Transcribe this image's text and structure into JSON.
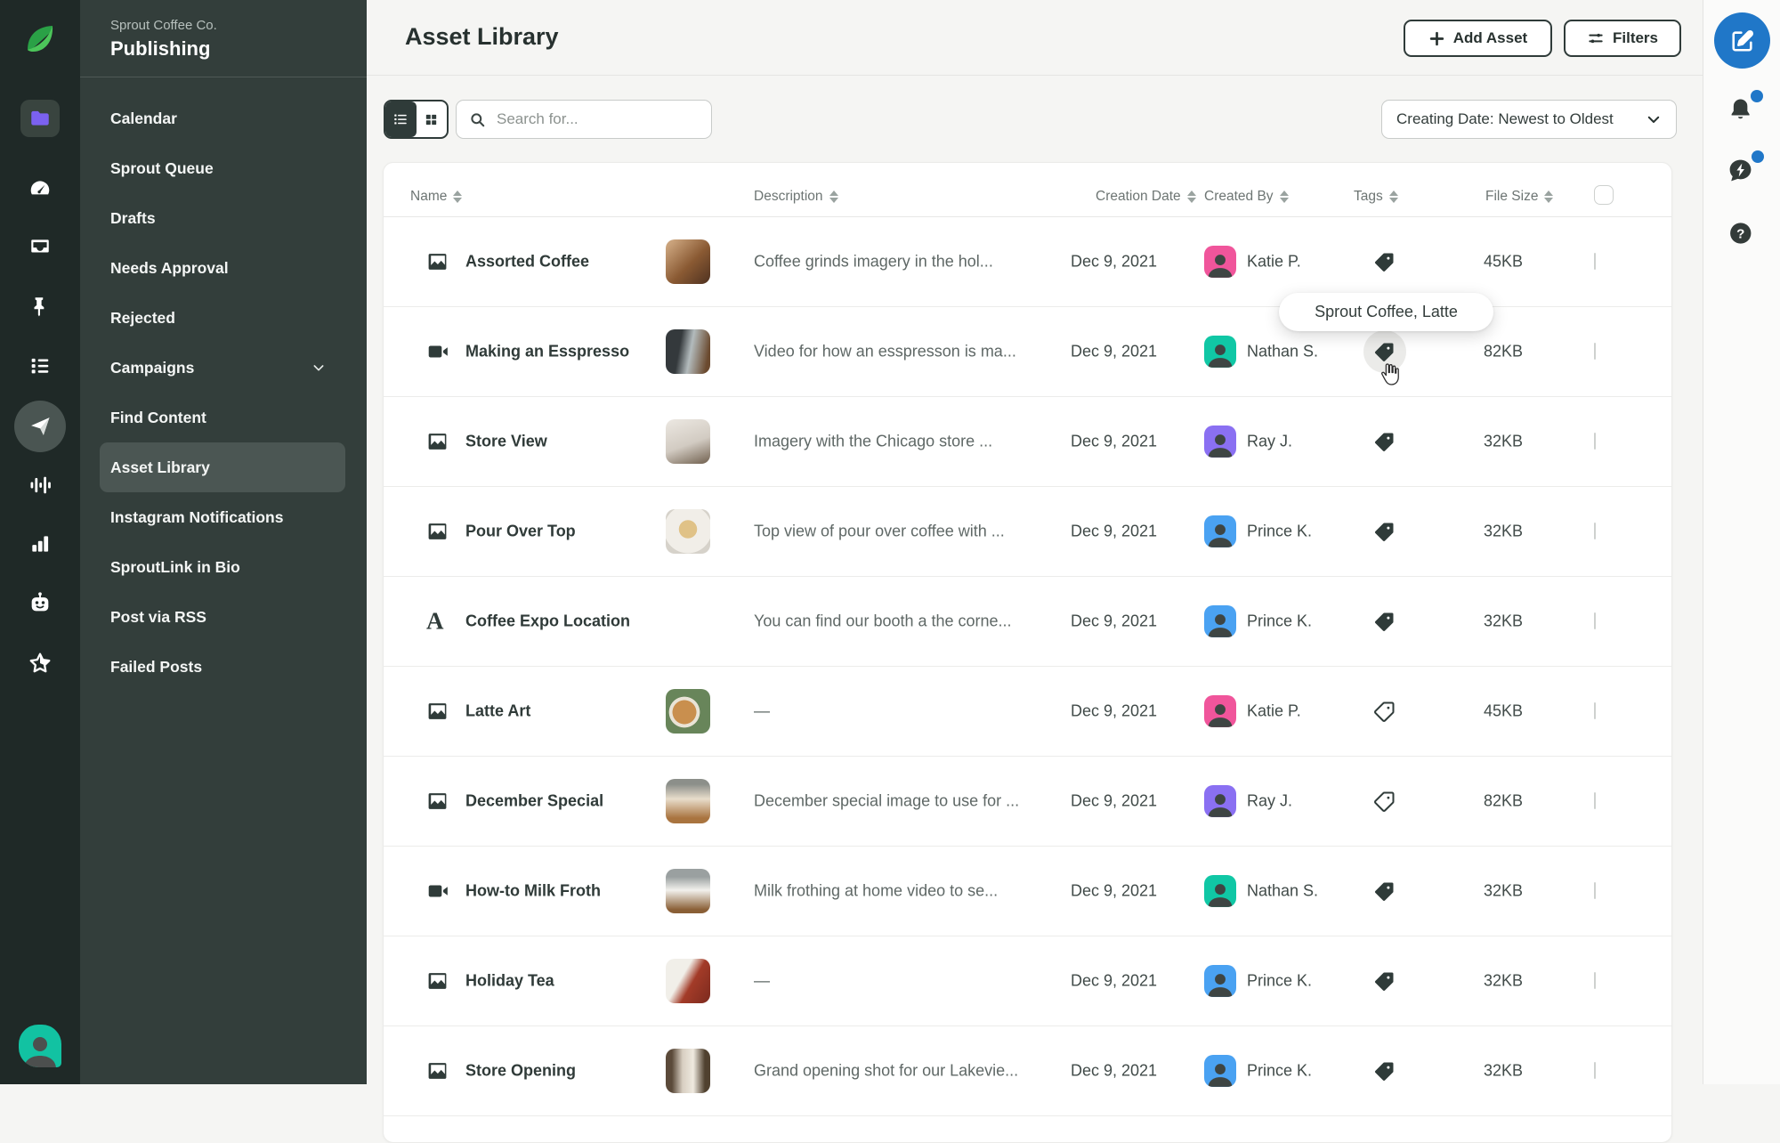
{
  "app": {
    "account": "Sprout Coffee Co.",
    "section": "Publishing"
  },
  "sidebar": {
    "items": [
      {
        "label": "Calendar"
      },
      {
        "label": "Sprout Queue"
      },
      {
        "label": "Drafts"
      },
      {
        "label": "Needs Approval"
      },
      {
        "label": "Rejected"
      },
      {
        "label": "Campaigns",
        "chevron": true
      },
      {
        "label": "Find Content"
      },
      {
        "label": "Asset Library",
        "active": true
      },
      {
        "label": "Instagram Notifications"
      },
      {
        "label": "SproutLink in Bio"
      },
      {
        "label": "Post via RSS"
      },
      {
        "label": "Failed Posts"
      }
    ]
  },
  "header": {
    "title": "Asset Library",
    "add_asset_label": "Add Asset",
    "filters_label": "Filters"
  },
  "controls": {
    "search_placeholder": "Search for...",
    "sort_value": "Creating Date: Newest to Oldest"
  },
  "table": {
    "columns": [
      "Name",
      "Description",
      "Creation Date",
      "Created By",
      "Tags",
      "File Size"
    ],
    "rows": [
      {
        "name": "Assorted Coffee",
        "type": "image",
        "thumb": 1,
        "description": "Coffee grinds imagery in the hol...",
        "date": "Dec 9, 2021",
        "creator": "Katie P.",
        "creator_color": "#f0559b",
        "tag": "filled",
        "size": "45KB"
      },
      {
        "name": "Making an Esspresso",
        "type": "video",
        "thumb": 2,
        "description": "Video for how an esspresson is ma...",
        "date": "Dec 9, 2021",
        "creator": "Nathan S.",
        "creator_color": "#10c7a5",
        "tag": "filled",
        "size": "82KB",
        "tag_hover": true
      },
      {
        "name": "Store View",
        "type": "image",
        "thumb": 3,
        "description": "Imagery with the Chicago store ...",
        "date": "Dec 9, 2021",
        "creator": "Ray J.",
        "creator_color": "#8a70f2",
        "tag": "filled",
        "size": "32KB"
      },
      {
        "name": "Pour Over Top",
        "type": "image",
        "thumb": 4,
        "description": "Top view of pour over coffee with ...",
        "date": "Dec 9, 2021",
        "creator": "Prince K.",
        "creator_color": "#4aa2f2",
        "tag": "filled",
        "size": "32KB"
      },
      {
        "name": "Coffee Expo Location",
        "type": "text",
        "thumb": null,
        "description": "You can find our booth a the corne...",
        "date": "Dec 9, 2021",
        "creator": "Prince K.",
        "creator_color": "#4aa2f2",
        "tag": "filled",
        "size": "32KB"
      },
      {
        "name": "Latte Art",
        "type": "image",
        "thumb": 6,
        "description": "—",
        "date": "Dec 9, 2021",
        "creator": "Katie P.",
        "creator_color": "#f0559b",
        "tag": "outline",
        "size": "45KB"
      },
      {
        "name": "December Special",
        "type": "image",
        "thumb": 7,
        "description": "December special image to use for ...",
        "date": "Dec 9, 2021",
        "creator": "Ray J.",
        "creator_color": "#8a70f2",
        "tag": "outline",
        "size": "82KB"
      },
      {
        "name": "How-to Milk Froth",
        "type": "video",
        "thumb": 8,
        "description": "Milk frothing at home video to se...",
        "date": "Dec 9, 2021",
        "creator": "Nathan S.",
        "creator_color": "#10c7a5",
        "tag": "filled",
        "size": "32KB"
      },
      {
        "name": "Holiday Tea",
        "type": "image",
        "thumb": 9,
        "description": "—",
        "date": "Dec 9, 2021",
        "creator": "Prince K.",
        "creator_color": "#4aa2f2",
        "tag": "filled",
        "size": "32KB"
      },
      {
        "name": "Store Opening",
        "type": "image",
        "thumb": 10,
        "description": "Grand opening shot for our Lakevie...",
        "date": "Dec 9, 2021",
        "creator": "Prince K.",
        "creator_color": "#4aa2f2",
        "tag": "filled",
        "size": "32KB"
      }
    ]
  },
  "tooltip": {
    "text": "Sprout Coffee, Latte"
  },
  "icons": {
    "rail": [
      "sprout-leaf-logo",
      "folder",
      "dashboard-gauge",
      "inbox-tray",
      "pin",
      "list",
      "paper-plane",
      "audio-wave",
      "bar-chart",
      "bot",
      "star",
      "user-avatar"
    ],
    "right_rail": [
      "compose",
      "bell",
      "message-lightning",
      "help"
    ]
  },
  "colors": {
    "accent_blue": "#2077c8",
    "folder_purple": "#7b61f0",
    "avatar_pink": "#f0559b",
    "avatar_teal": "#10c7a5",
    "avatar_purple": "#8a70f2",
    "avatar_blue": "#4aa2f2"
  }
}
